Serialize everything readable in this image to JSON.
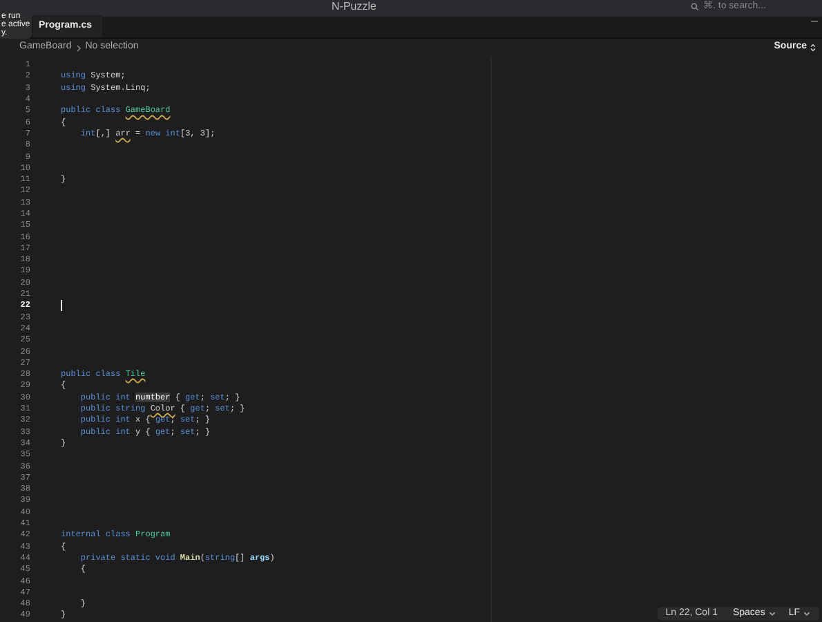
{
  "window": {
    "title": "N-Puzzle",
    "search": {
      "placeholder": "⌘. to search..."
    }
  },
  "tooltip": {
    "lines": [
      "e run",
      "e active",
      "y."
    ]
  },
  "tabs": [
    {
      "label": "Program.cs",
      "selected": true
    }
  ],
  "breadcrumb": {
    "items": [
      "GameBoard",
      "No selection"
    ],
    "view_mode": "Source"
  },
  "editor": {
    "lines": [
      {
        "number": "1",
        "current": false
      },
      {
        "number": "2",
        "current": false,
        "tokens": [
          {
            "text": "using ",
            "kind": "kw"
          },
          {
            "text": "System;",
            "kind": "plain"
          }
        ]
      },
      {
        "number": "3",
        "current": false,
        "tokens": [
          {
            "text": "using ",
            "kind": "kw"
          },
          {
            "text": "System.Linq;",
            "kind": "plain"
          }
        ]
      },
      {
        "number": "4",
        "current": false
      },
      {
        "number": "5",
        "current": false,
        "tokens": [
          {
            "text": "public class ",
            "kind": "kw"
          },
          {
            "text": "GameBoard",
            "kind": "type",
            "squiggle": true
          }
        ]
      },
      {
        "number": "6",
        "current": false,
        "tokens": [
          {
            "text": "{",
            "kind": "plain"
          }
        ]
      },
      {
        "number": "7",
        "current": false,
        "tokens": [
          {
            "text": "    int",
            "kind": "kw"
          },
          {
            "text": "[,] ",
            "kind": "plain"
          },
          {
            "text": "arr",
            "kind": "plain",
            "squiggle": true
          },
          {
            "text": " = ",
            "kind": "plain"
          },
          {
            "text": "new int",
            "kind": "kw"
          },
          {
            "text": "[3, 3];",
            "kind": "plain"
          }
        ]
      },
      {
        "number": "8",
        "current": false
      },
      {
        "number": "9",
        "current": false
      },
      {
        "number": "10",
        "current": false
      },
      {
        "number": "11",
        "current": false,
        "tokens": [
          {
            "text": "}",
            "kind": "plain"
          }
        ]
      },
      {
        "number": "12",
        "current": false
      },
      {
        "number": "13",
        "current": false
      },
      {
        "number": "14",
        "current": false
      },
      {
        "number": "15",
        "current": false
      },
      {
        "number": "16",
        "current": false
      },
      {
        "number": "17",
        "current": false
      },
      {
        "number": "18",
        "current": false
      },
      {
        "number": "19",
        "current": false
      },
      {
        "number": "20",
        "current": false
      },
      {
        "number": "21",
        "current": false
      },
      {
        "number": "22",
        "current": true
      },
      {
        "number": "23",
        "current": false
      },
      {
        "number": "24",
        "current": false
      },
      {
        "number": "25",
        "current": false
      },
      {
        "number": "26",
        "current": false
      },
      {
        "number": "27",
        "current": false
      },
      {
        "number": "28",
        "current": false,
        "tokens": [
          {
            "text": "public class ",
            "kind": "kw"
          },
          {
            "text": "Tile",
            "kind": "type",
            "squiggle": true
          }
        ]
      },
      {
        "number": "29",
        "current": false,
        "tokens": [
          {
            "text": "{",
            "kind": "plain"
          }
        ]
      },
      {
        "number": "30",
        "current": false,
        "tokens": [
          {
            "text": "    public int ",
            "kind": "kw"
          },
          {
            "text": "numtber",
            "kind": "plain",
            "highlight": true
          },
          {
            "text": " { ",
            "kind": "plain"
          },
          {
            "text": "get",
            "kind": "kw"
          },
          {
            "text": "; ",
            "kind": "plain"
          },
          {
            "text": "set",
            "kind": "kw"
          },
          {
            "text": "; }",
            "kind": "plain"
          }
        ]
      },
      {
        "number": "31",
        "current": false,
        "tokens": [
          {
            "text": "    public string ",
            "kind": "kw"
          },
          {
            "text": "Color",
            "kind": "plain",
            "squiggle": true
          },
          {
            "text": " { ",
            "kind": "plain"
          },
          {
            "text": "get",
            "kind": "kw"
          },
          {
            "text": "; ",
            "kind": "plain"
          },
          {
            "text": "set",
            "kind": "kw"
          },
          {
            "text": "; }",
            "kind": "plain"
          }
        ]
      },
      {
        "number": "32",
        "current": false,
        "tokens": [
          {
            "text": "    public int",
            "kind": "kw"
          },
          {
            "text": " x { ",
            "kind": "plain"
          },
          {
            "text": "get",
            "kind": "kw"
          },
          {
            "text": "; ",
            "kind": "plain"
          },
          {
            "text": "set",
            "kind": "kw"
          },
          {
            "text": "; }",
            "kind": "plain"
          }
        ]
      },
      {
        "number": "33",
        "current": false,
        "tokens": [
          {
            "text": "    public int",
            "kind": "kw"
          },
          {
            "text": " y { ",
            "kind": "plain"
          },
          {
            "text": "get",
            "kind": "kw"
          },
          {
            "text": "; ",
            "kind": "plain"
          },
          {
            "text": "set",
            "kind": "kw"
          },
          {
            "text": "; }",
            "kind": "plain"
          }
        ]
      },
      {
        "number": "34",
        "current": false,
        "tokens": [
          {
            "text": "}",
            "kind": "plain"
          }
        ]
      },
      {
        "number": "35",
        "current": false
      },
      {
        "number": "36",
        "current": false
      },
      {
        "number": "37",
        "current": false
      },
      {
        "number": "38",
        "current": false
      },
      {
        "number": "39",
        "current": false
      },
      {
        "number": "40",
        "current": false
      },
      {
        "number": "41",
        "current": false
      },
      {
        "number": "42",
        "current": false,
        "tokens": [
          {
            "text": "internal class ",
            "kind": "kw"
          },
          {
            "text": "Program",
            "kind": "type"
          }
        ]
      },
      {
        "number": "43",
        "current": false,
        "tokens": [
          {
            "text": "{",
            "kind": "plain"
          }
        ]
      },
      {
        "number": "44",
        "current": false,
        "tokens": [
          {
            "text": "    private static void ",
            "kind": "kw"
          },
          {
            "text": "Main",
            "kind": "fn"
          },
          {
            "text": "(",
            "kind": "plain"
          },
          {
            "text": "string",
            "kind": "kw"
          },
          {
            "text": "[] ",
            "kind": "plain"
          },
          {
            "text": "args",
            "kind": "param"
          },
          {
            "text": ")",
            "kind": "plain"
          }
        ]
      },
      {
        "number": "45",
        "current": false,
        "tokens": [
          {
            "text": "    {",
            "kind": "plain"
          }
        ]
      },
      {
        "number": "46",
        "current": false
      },
      {
        "number": "47",
        "current": false
      },
      {
        "number": "48",
        "current": false,
        "tokens": [
          {
            "text": "    }",
            "kind": "plain"
          }
        ]
      },
      {
        "number": "49",
        "current": false,
        "tokens": [
          {
            "text": "}",
            "kind": "plain"
          }
        ]
      }
    ]
  },
  "status_bar": {
    "position": "Ln 22, Col 1",
    "indentation": "Spaces",
    "line_endings": "LF"
  }
}
